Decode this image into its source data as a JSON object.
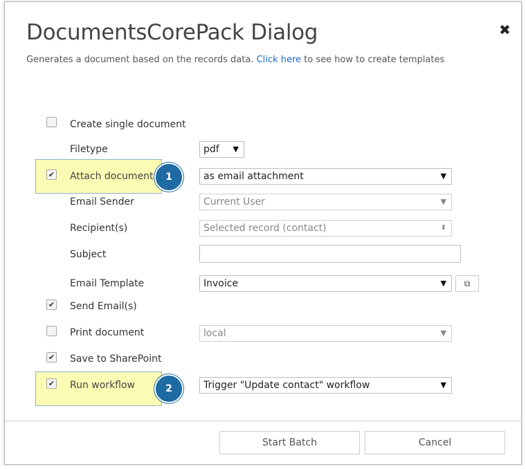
{
  "dialog": {
    "title": "DocumentsCorePack Dialog",
    "close_icon": "close-icon",
    "subtitle_prefix": "Generates a document based on the records data.",
    "subtitle_link": "Click here",
    "subtitle_suffix": "to see how to create templates"
  },
  "form": {
    "create_single": {
      "label": "Create single document",
      "checked": false
    },
    "filetype": {
      "label": "Filetype",
      "value": "pdf"
    },
    "attach": {
      "label": "Attach document",
      "checked": true,
      "value": "as email attachment",
      "badge": "1"
    },
    "email_sender": {
      "label": "Email Sender",
      "value": "Current User"
    },
    "recipients": {
      "label": "Recipient(s)",
      "value": "Selected record (contact)"
    },
    "subject": {
      "label": "Subject",
      "value": ""
    },
    "email_template": {
      "label": "Email Template",
      "value": "Invoice",
      "open_icon": "external-link-icon"
    },
    "send_email": {
      "label": "Send Email(s)",
      "checked": true
    },
    "print_document": {
      "label": "Print document",
      "checked": false,
      "value": "local"
    },
    "save_sharepoint": {
      "label": "Save to SharePoint",
      "checked": true
    },
    "run_workflow": {
      "label": "Run workflow",
      "checked": true,
      "value": "Trigger \"Update contact\" workflow",
      "badge": "2"
    }
  },
  "footer": {
    "start_batch": "Start Batch",
    "cancel": "Cancel"
  },
  "colors": {
    "highlight": "#fbfbb4",
    "badge": "#1e6aa3",
    "link": "#1b6ac9"
  }
}
